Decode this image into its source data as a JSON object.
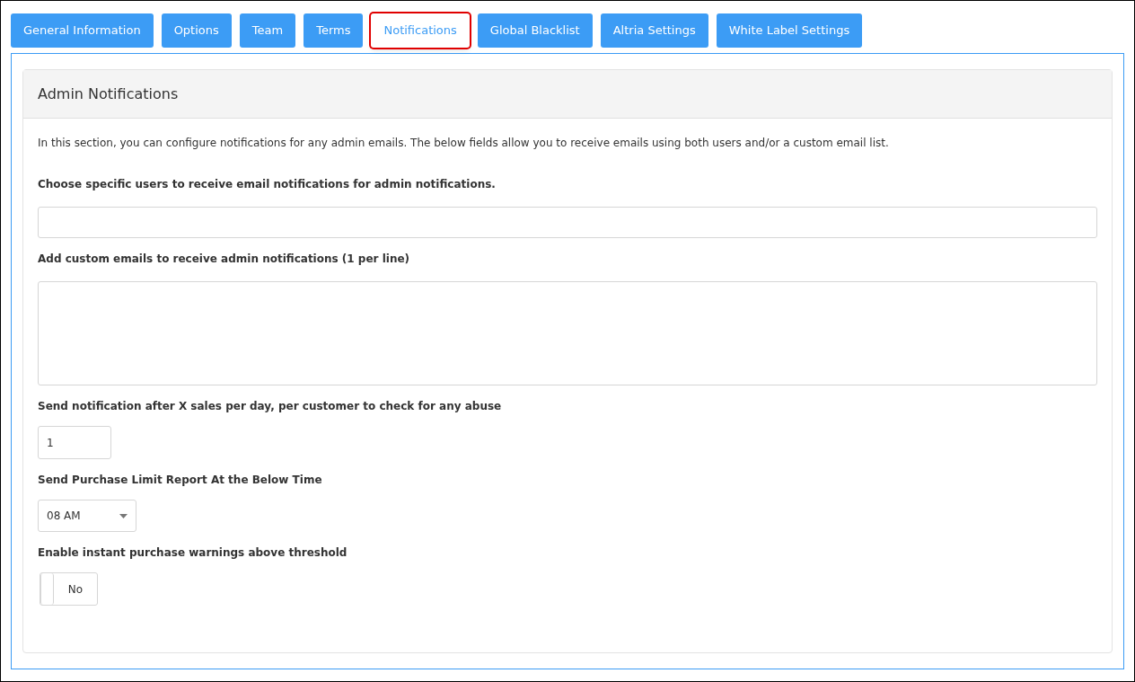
{
  "tabs": [
    {
      "label": "General Information",
      "selected": false,
      "highlighted": false
    },
    {
      "label": "Options",
      "selected": false,
      "highlighted": false
    },
    {
      "label": "Team",
      "selected": false,
      "highlighted": false
    },
    {
      "label": "Terms",
      "selected": false,
      "highlighted": false
    },
    {
      "label": "Notifications",
      "selected": true,
      "highlighted": true
    },
    {
      "label": "Global Blacklist",
      "selected": false,
      "highlighted": false
    },
    {
      "label": "Altria Settings",
      "selected": false,
      "highlighted": false
    },
    {
      "label": "White Label Settings",
      "selected": false,
      "highlighted": false
    }
  ],
  "card": {
    "title": "Admin Notifications",
    "description": "In this section, you can configure notifications for any admin emails. The below fields allow you to receive emails using both users and/or a custom email list.",
    "fields": [
      {
        "kind": "input",
        "label": "Choose specific users to receive email notifications for admin notifications."
      },
      {
        "kind": "textarea",
        "label": "Add custom emails to receive admin notifications (1 per line)"
      },
      {
        "kind": "number",
        "label": "Send notification after X sales per day, per customer to check for any abuse",
        "value": "1"
      },
      {
        "kind": "select",
        "label": "Send Purchase Limit Report At the Below Time",
        "value": "08 AM"
      },
      {
        "kind": "toggle",
        "label": "Enable instant purchase warnings above threshold",
        "on": false,
        "text": "No"
      }
    ]
  }
}
